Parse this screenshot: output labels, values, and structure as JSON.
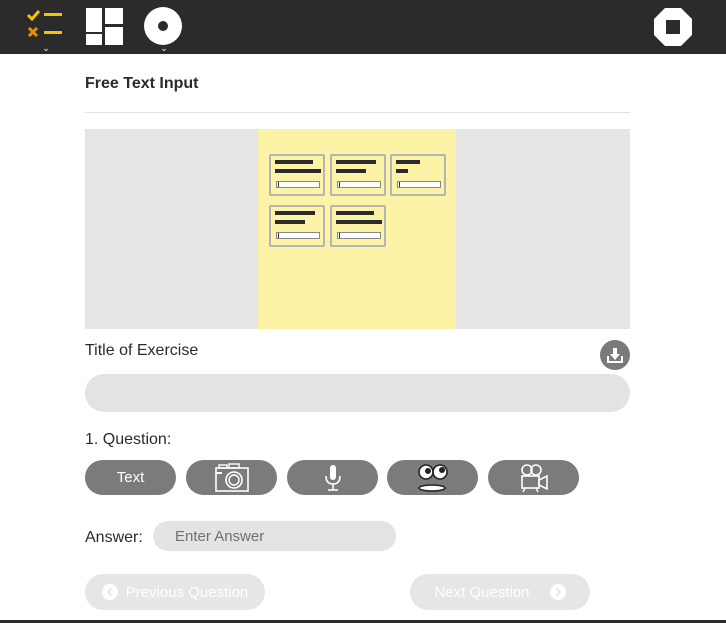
{
  "toolbar": {
    "left_icons": [
      "checklist-icon",
      "layout-grid-icon",
      "record-disc-icon"
    ],
    "right_icon": "stop-icon",
    "accent_check": "#f5c400",
    "accent_cross": "#f08a00"
  },
  "page": {
    "title": "Free Text Input"
  },
  "preview": {
    "background": "#e5e5e5",
    "sheet_color": "#fdf3a6"
  },
  "exercise": {
    "title_label": "Title of Exercise",
    "title_value": "",
    "download_icon": "download-icon"
  },
  "question": {
    "label": "1. Question:",
    "types": [
      {
        "label": "Text",
        "icon": ""
      },
      {
        "label": "",
        "icon": "camera-icon"
      },
      {
        "label": "",
        "icon": "microphone-icon"
      },
      {
        "label": "",
        "icon": "eyes-face-icon"
      },
      {
        "label": "",
        "icon": "video-camera-icon"
      }
    ]
  },
  "answer": {
    "label": "Answer:",
    "placeholder": "Enter Answer",
    "value": ""
  },
  "navigation": {
    "previous_label": "Previous Question",
    "next_label": "Next Question"
  }
}
